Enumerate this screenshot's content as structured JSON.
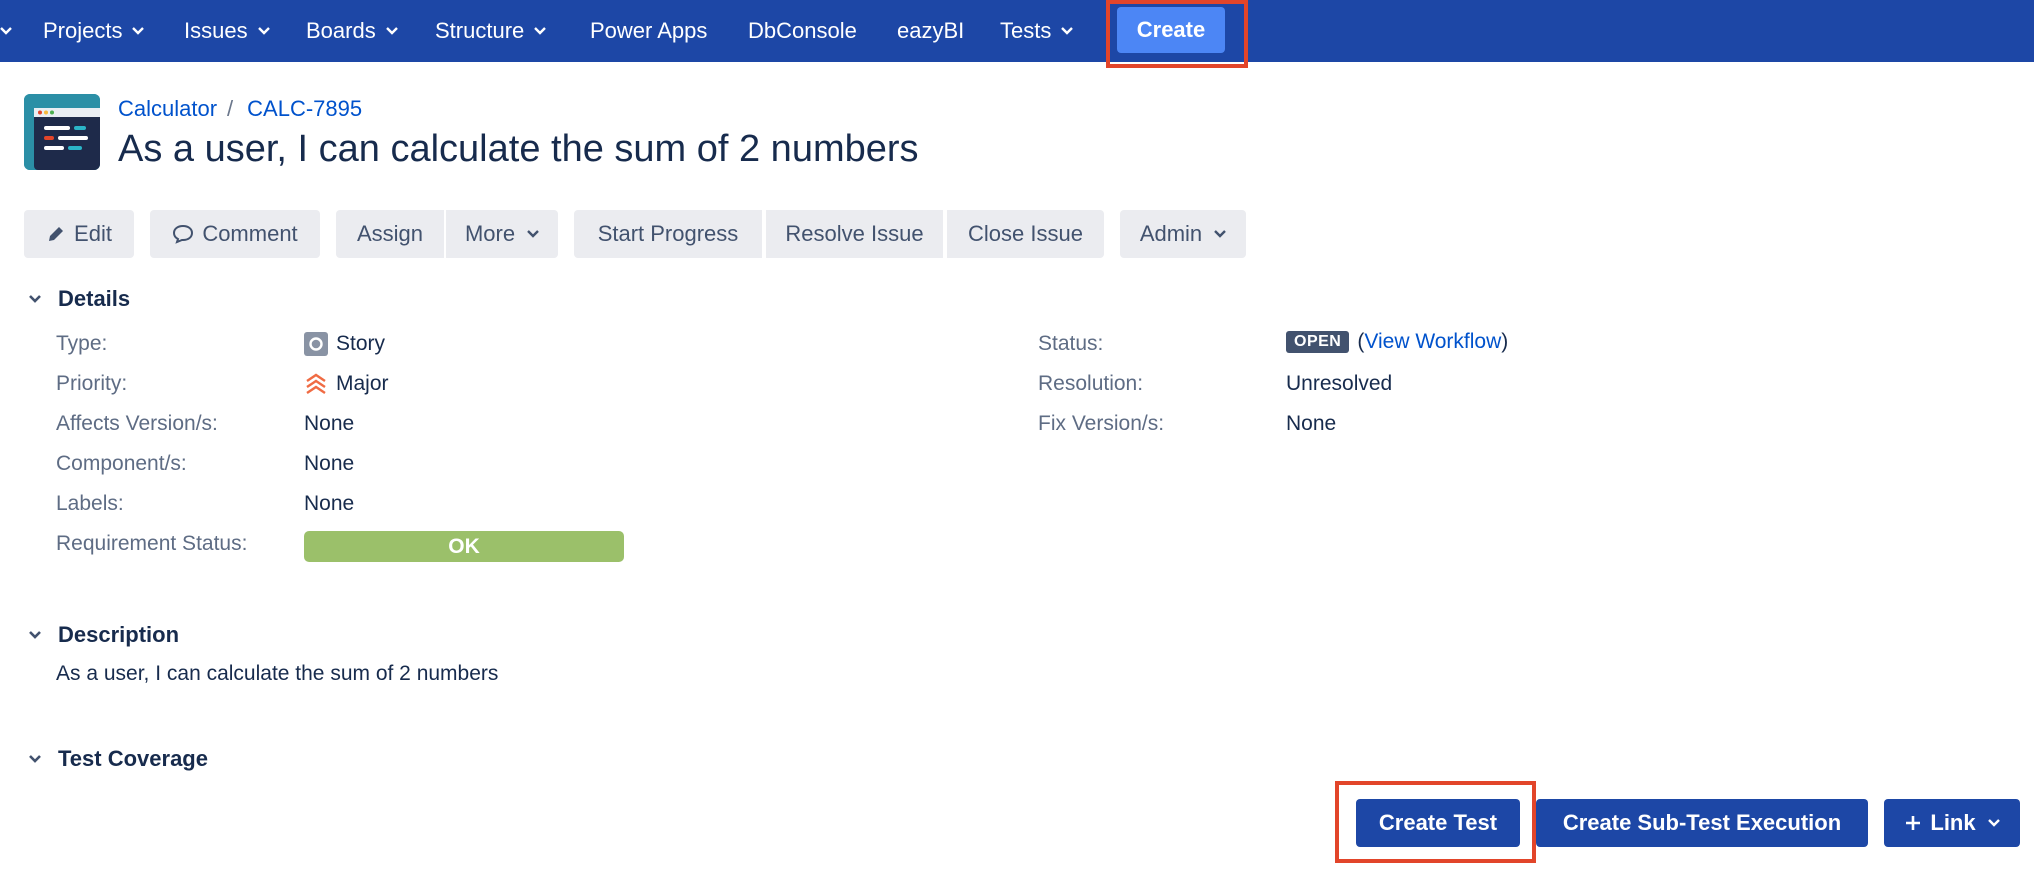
{
  "nav": {
    "items": [
      {
        "label": "Projects"
      },
      {
        "label": "Issues"
      },
      {
        "label": "Boards"
      },
      {
        "label": "Structure"
      },
      {
        "label": "Power Apps"
      },
      {
        "label": "DbConsole"
      },
      {
        "label": "eazyBI"
      },
      {
        "label": "Tests"
      }
    ],
    "create_label": "Create"
  },
  "breadcrumb": {
    "project": "Calculator",
    "separator": "/",
    "issue_key": "CALC-7895"
  },
  "issue": {
    "title": "As a user, I can calculate the sum of 2 numbers"
  },
  "toolbar": {
    "edit": "Edit",
    "comment": "Comment",
    "assign": "Assign",
    "more": "More",
    "start_progress": "Start Progress",
    "resolve_issue": "Resolve Issue",
    "close_issue": "Close Issue",
    "admin": "Admin"
  },
  "details": {
    "heading": "Details",
    "type_label": "Type:",
    "type_value": "Story",
    "priority_label": "Priority:",
    "priority_value": "Major",
    "affects_label": "Affects Version/s:",
    "affects_value": "None",
    "component_label": "Component/s:",
    "component_value": "None",
    "labels_label": "Labels:",
    "labels_value": "None",
    "req_status_label": "Requirement Status:",
    "req_status_value": "OK",
    "status_label": "Status:",
    "status_value": "OPEN",
    "workflow_open": "(",
    "workflow_link": "View Workflow",
    "workflow_close": ")",
    "resolution_label": "Resolution:",
    "resolution_value": "Unresolved",
    "fix_label": "Fix Version/s:",
    "fix_value": "None"
  },
  "description": {
    "heading": "Description",
    "text": "As a user, I can calculate the sum of 2 numbers"
  },
  "test_coverage": {
    "heading": "Test Coverage",
    "create_test": "Create Test",
    "create_sub_test_execution": "Create Sub-Test Execution",
    "link": "Link"
  },
  "colors": {
    "nav_bg": "#1d47a6",
    "create_btn": "#4c86f5",
    "highlight": "#e2452a",
    "link": "#0052cc",
    "ok_bar": "#9bc06a",
    "open_lozenge": "#42526e"
  }
}
